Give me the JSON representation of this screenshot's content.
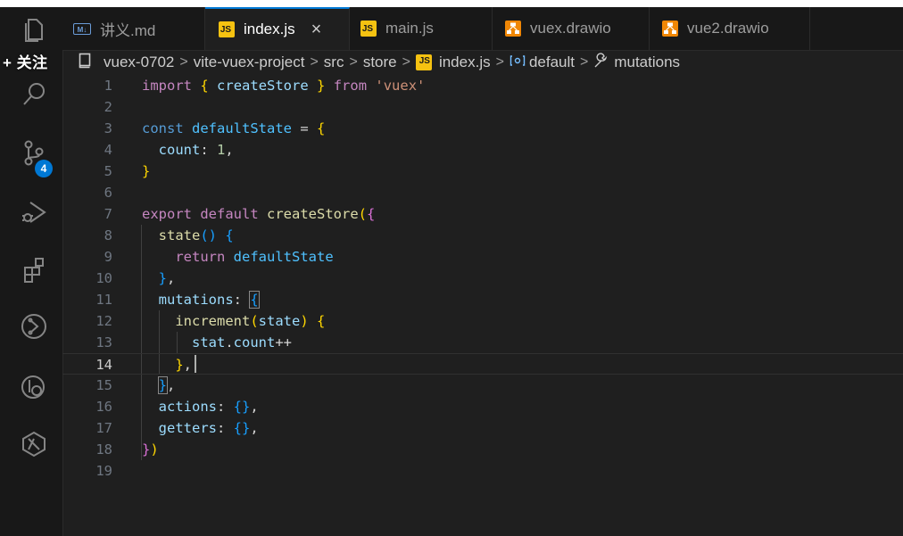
{
  "overlay": {
    "follow_label": "+ 关注"
  },
  "activity": {
    "source_control_badge": "4"
  },
  "tabs": [
    {
      "label": "讲义.md",
      "icon": "markdown-icon"
    },
    {
      "label": "index.js",
      "icon": "js-icon",
      "close": "×"
    },
    {
      "label": "main.js",
      "icon": "js-icon"
    },
    {
      "label": "vuex.drawio",
      "icon": "drawio-icon"
    },
    {
      "label": "vue2.drawio",
      "icon": "drawio-icon"
    }
  ],
  "icon_text": {
    "markdown": "M↓",
    "js": "JS"
  },
  "breadcrumb": {
    "items": [
      "vuex-0702",
      "vite-vuex-project",
      "src",
      "store",
      "index.js",
      "default",
      "mutations"
    ],
    "separator": ">"
  },
  "editor": {
    "current_line": 14,
    "lines": [
      {
        "n": "1",
        "t": [
          [
            "kw",
            "import"
          ],
          [
            "pn",
            " "
          ],
          [
            "br1",
            "{"
          ],
          [
            "pn",
            " "
          ],
          [
            "var",
            "createStore"
          ],
          [
            "pn",
            " "
          ],
          [
            "br1",
            "}"
          ],
          [
            "pn",
            " "
          ],
          [
            "kw",
            "from"
          ],
          [
            "pn",
            " "
          ],
          [
            "str",
            "'vuex'"
          ]
        ]
      },
      {
        "n": "2",
        "t": []
      },
      {
        "n": "3",
        "t": [
          [
            "kwb",
            "const"
          ],
          [
            "pn",
            " "
          ],
          [
            "cst",
            "defaultState"
          ],
          [
            "pn",
            " = "
          ],
          [
            "br1",
            "{"
          ]
        ]
      },
      {
        "n": "4",
        "t": [
          [
            "pn",
            "  "
          ],
          [
            "var",
            "count"
          ],
          [
            "pn",
            ": "
          ],
          [
            "num",
            "1"
          ],
          [
            "pn",
            ","
          ]
        ]
      },
      {
        "n": "5",
        "t": [
          [
            "br1",
            "}"
          ]
        ]
      },
      {
        "n": "6",
        "t": []
      },
      {
        "n": "7",
        "t": [
          [
            "kw",
            "export"
          ],
          [
            "pn",
            " "
          ],
          [
            "kw",
            "default"
          ],
          [
            "pn",
            " "
          ],
          [
            "fn",
            "createStore"
          ],
          [
            "br1",
            "("
          ],
          [
            "br2",
            "{"
          ]
        ]
      },
      {
        "n": "8",
        "t": [
          [
            "pn",
            "  "
          ],
          [
            "fn",
            "state"
          ],
          [
            "br3",
            "()"
          ],
          [
            "pn",
            " "
          ],
          [
            "br3",
            "{"
          ]
        ]
      },
      {
        "n": "9",
        "t": [
          [
            "pn",
            "    "
          ],
          [
            "kw",
            "return"
          ],
          [
            "pn",
            " "
          ],
          [
            "cst",
            "defaultState"
          ]
        ]
      },
      {
        "n": "10",
        "t": [
          [
            "pn",
            "  "
          ],
          [
            "br3",
            "}"
          ],
          [
            "pn",
            ","
          ]
        ]
      },
      {
        "n": "11",
        "t": [
          [
            "pn",
            "  "
          ],
          [
            "var",
            "mutations"
          ],
          [
            "pn",
            ": "
          ],
          [
            "br3",
            "{",
            "bm"
          ]
        ]
      },
      {
        "n": "12",
        "t": [
          [
            "pn",
            "    "
          ],
          [
            "fn",
            "increment"
          ],
          [
            "br1",
            "("
          ],
          [
            "var",
            "state"
          ],
          [
            "br1",
            ")"
          ],
          [
            "pn",
            " "
          ],
          [
            "br1",
            "{"
          ]
        ]
      },
      {
        "n": "13",
        "t": [
          [
            "pn",
            "      "
          ],
          [
            "var",
            "stat"
          ],
          [
            "pn",
            "."
          ],
          [
            "var",
            "count"
          ],
          [
            "pn",
            "++"
          ]
        ]
      },
      {
        "n": "14",
        "t": [
          [
            "pn",
            "    "
          ],
          [
            "br1",
            "}"
          ],
          [
            "pn",
            ","
          ]
        ]
      },
      {
        "n": "15",
        "t": [
          [
            "pn",
            "  "
          ],
          [
            "br3",
            "}",
            "bm"
          ],
          [
            "pn",
            ","
          ]
        ]
      },
      {
        "n": "16",
        "t": [
          [
            "pn",
            "  "
          ],
          [
            "var",
            "actions"
          ],
          [
            "pn",
            ": "
          ],
          [
            "br3",
            "{}"
          ],
          [
            "pn",
            ","
          ]
        ]
      },
      {
        "n": "17",
        "t": [
          [
            "pn",
            "  "
          ],
          [
            "var",
            "getters"
          ],
          [
            "pn",
            ": "
          ],
          [
            "br3",
            "{}"
          ],
          [
            "pn",
            ","
          ]
        ]
      },
      {
        "n": "18",
        "t": [
          [
            "br2",
            "}"
          ],
          [
            "br1",
            ")"
          ]
        ]
      },
      {
        "n": "19",
        "t": []
      }
    ]
  }
}
